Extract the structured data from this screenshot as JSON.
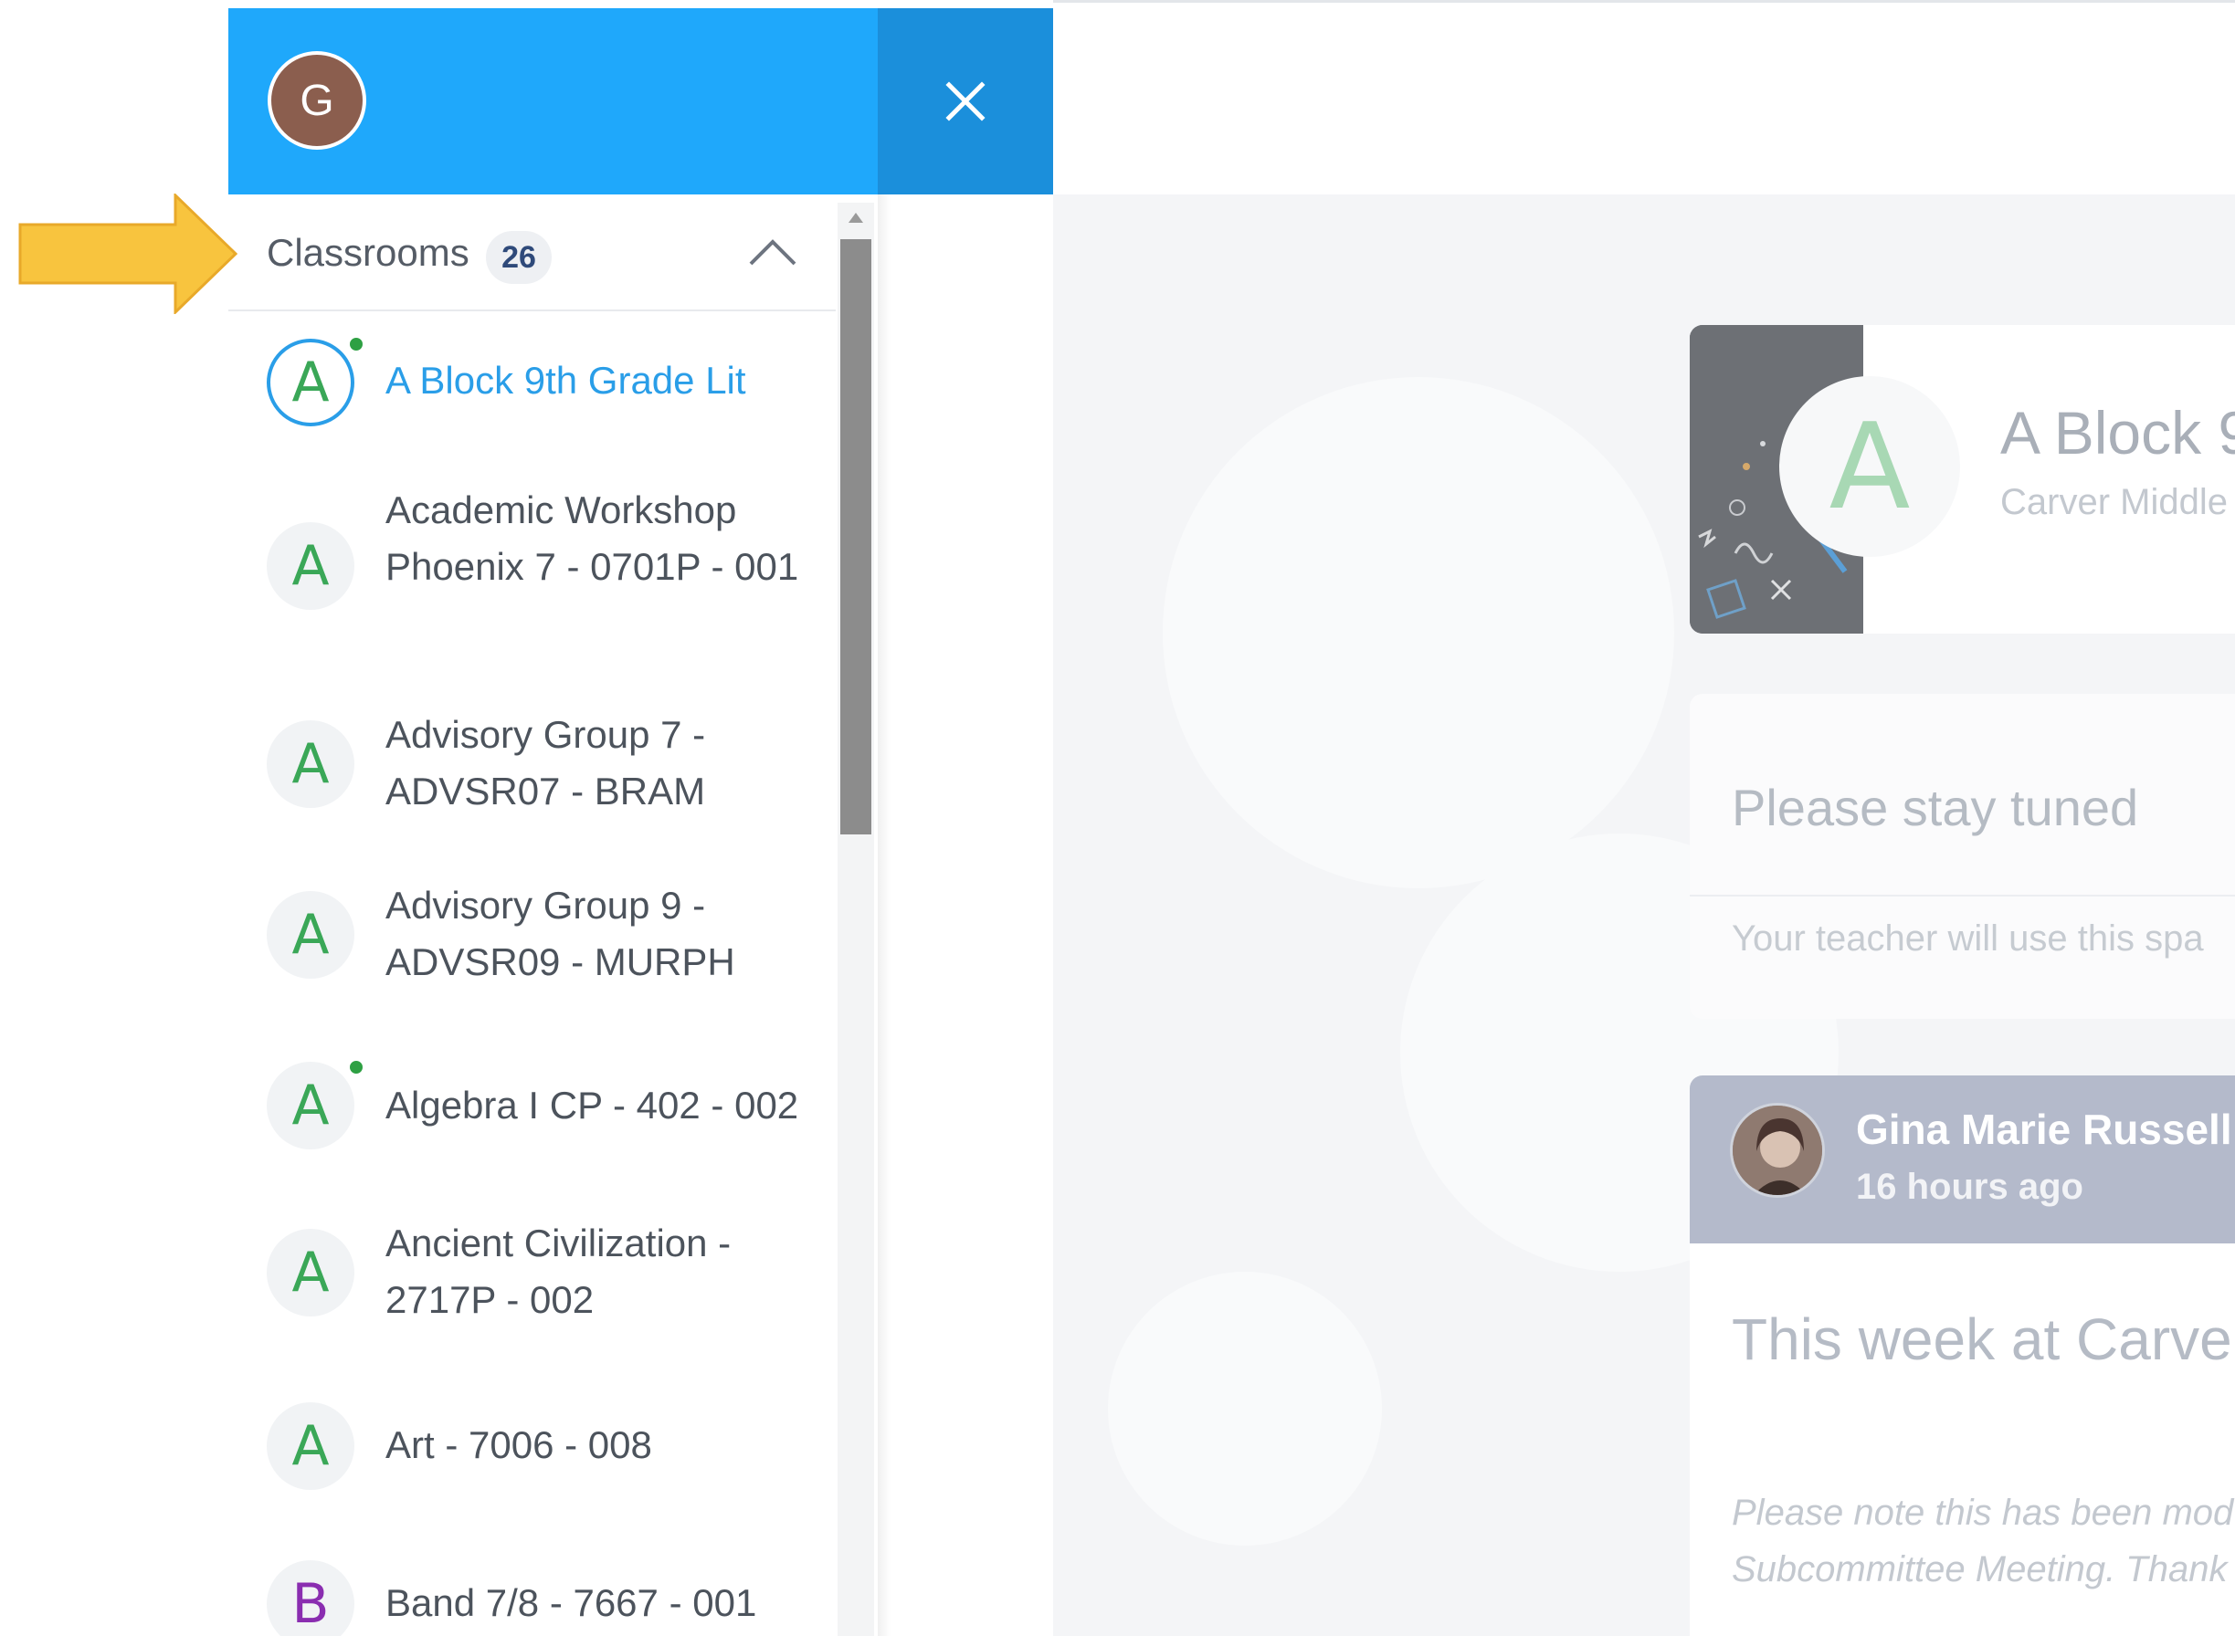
{
  "header": {
    "avatar_initial": "G",
    "close_label": "×"
  },
  "sidebar": {
    "section_title": "Classrooms",
    "section_count": "26",
    "items": [
      {
        "letter": "A",
        "label": "A Block 9th Grade Lit",
        "active": true,
        "dot": true
      },
      {
        "letter": "A",
        "label": "Academic Workshop Phoenix 7 - 0701P - 001"
      },
      {
        "letter": "A",
        "label": "Advisory Group 7 - ADVSR07 - BRAM"
      },
      {
        "letter": "A",
        "label": "Advisory Group 9 - ADVSR09 - MURPH"
      },
      {
        "letter": "A",
        "label": "Algebra I CP - 402 - 002",
        "dot": true
      },
      {
        "letter": "A",
        "label": "Ancient Civilization - 2717P - 002"
      },
      {
        "letter": "A",
        "label": "Art - 7006 - 008"
      },
      {
        "letter": "B",
        "label": "Band 7/8 - 7667 - 001"
      }
    ]
  },
  "class_card": {
    "logo_letter": "A",
    "title": "A Block 9",
    "subtitle": "Carver Middle"
  },
  "notice_card": {
    "title": "Please stay tuned",
    "text": "Your teacher will use this spa"
  },
  "post": {
    "author": "Gina Marie Russell",
    "time": "16 hours ago",
    "title": "This week at Carve",
    "body_line1": "Please note this has been mod",
    "body_line2": "Subcommittee Meeting. Thank"
  },
  "colors": {
    "header_blue": "#1fa8fb",
    "close_blue": "#1b8fdb",
    "active_blue": "#2a9ee8",
    "letter_green": "#3aa757",
    "arrow_yellow": "#f8c43e"
  }
}
